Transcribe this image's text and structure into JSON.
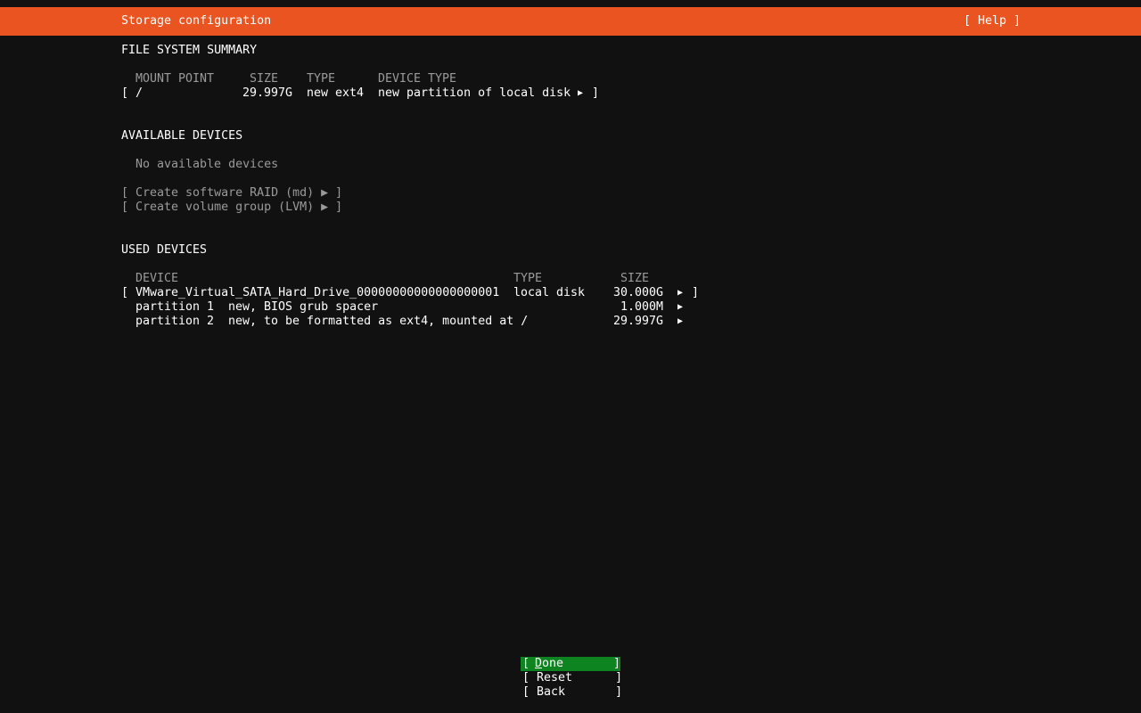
{
  "header": {
    "title": "Storage configuration",
    "help_label": "[ Help ]",
    "accent_color": "#e95420"
  },
  "fs_summary": {
    "heading": "FILE SYSTEM SUMMARY",
    "columns": {
      "mount_point": "MOUNT POINT",
      "size": "SIZE",
      "type": "TYPE",
      "device_type": "DEVICE TYPE"
    },
    "rows": [
      {
        "open_bracket": "[",
        "mount_point": "/",
        "size": "29.997G",
        "type": "new ext4",
        "device_type": "new partition of local disk",
        "arrow": "▶",
        "close_bracket": "]"
      }
    ]
  },
  "available_devices": {
    "heading": "AVAILABLE DEVICES",
    "empty_text": "No available devices",
    "actions": [
      {
        "label": "[ Create software RAID (md) ▶ ]"
      },
      {
        "label": "[ Create volume group (LVM) ▶ ]"
      }
    ]
  },
  "used_devices": {
    "heading": "USED DEVICES",
    "columns": {
      "device": "DEVICE",
      "type": "TYPE",
      "size": "SIZE"
    },
    "disk": {
      "open_bracket": "[",
      "device": "VMware_Virtual_SATA_Hard_Drive_00000000000000000001",
      "type": "local disk",
      "size": "30.000G",
      "arrow": "▶",
      "close_bracket": "]"
    },
    "partitions": [
      {
        "name": "partition 1",
        "desc": "new, BIOS grub spacer",
        "size": "1.000M",
        "arrow": "▶"
      },
      {
        "name": "partition 2",
        "desc": "new, to be formatted as ext4, mounted at /",
        "size": "29.997G",
        "arrow": "▶"
      }
    ]
  },
  "buttons": {
    "done": {
      "open": "[",
      "hotkey": "D",
      "rest": "one",
      "close": "]",
      "color": "#0e8420"
    },
    "reset": "[ Reset      ]",
    "back": "[ Back       ]"
  }
}
